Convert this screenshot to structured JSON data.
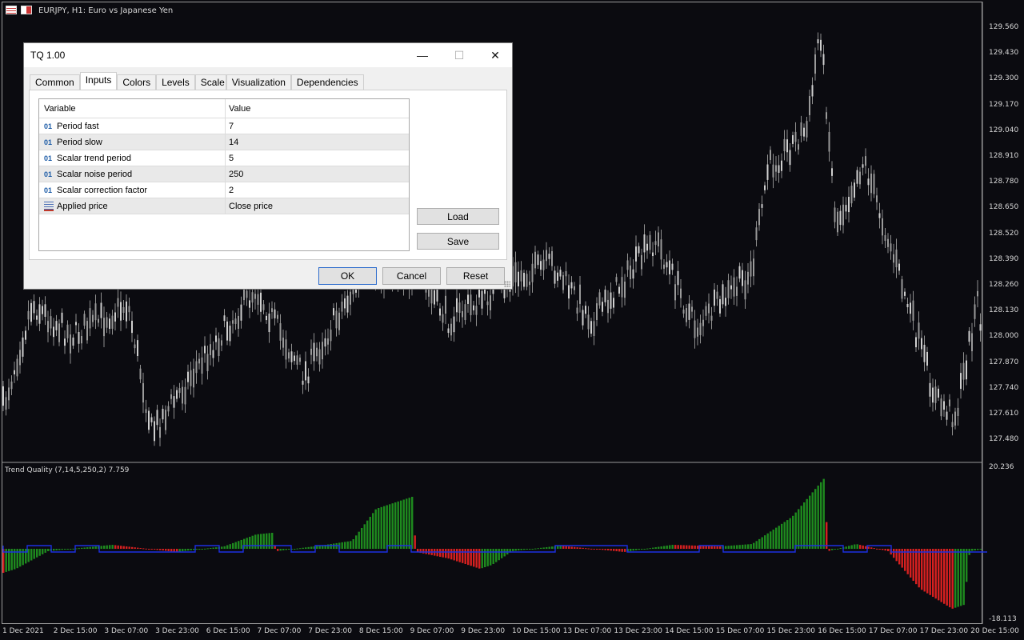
{
  "window": {
    "caption": "EURJPY, H1:  Euro vs Japanese Yen"
  },
  "price_axis": [
    "129.560",
    "129.430",
    "129.300",
    "129.170",
    "129.040",
    "128.910",
    "128.780",
    "128.650",
    "128.520",
    "128.390",
    "128.260",
    "128.130",
    "128.000",
    "127.870",
    "127.740",
    "127.610",
    "127.480"
  ],
  "indicator_axis": [
    "20.236",
    "-18.113"
  ],
  "time_axis": [
    "1 Dec 2021",
    "2 Dec 15:00",
    "3 Dec 07:00",
    "3 Dec 23:00",
    "6 Dec 15:00",
    "7 Dec 07:00",
    "7 Dec 23:00",
    "8 Dec 15:00",
    "9 Dec 07:00",
    "9 Dec 23:00",
    "10 Dec 15:00",
    "13 Dec 07:00",
    "13 Dec 23:00",
    "14 Dec 15:00",
    "15 Dec 07:00",
    "15 Dec 23:00",
    "16 Dec 15:00",
    "17 Dec 07:00",
    "17 Dec 23:00",
    "20 Dec 15:00"
  ],
  "indicator": {
    "title": "Trend Quality (7,14,5,250,2) 7.759",
    "colors": {
      "up": "#1e8a1e",
      "down": "#d62020",
      "line": "#1c2fe0"
    }
  },
  "dialog": {
    "title": "TQ 1.00",
    "minimize": "—",
    "maximize": "☐",
    "close": "✕",
    "tabs": [
      "Common",
      "Inputs",
      "Colors",
      "Levels",
      "Scale",
      "Visualization",
      "Dependencies"
    ],
    "active_tab": "Inputs",
    "grid": {
      "header": {
        "variable": "Variable",
        "value": "Value"
      },
      "rows": [
        {
          "type": "01",
          "name": "Period fast",
          "value": "7"
        },
        {
          "type": "01",
          "name": "Period slow",
          "value": "14"
        },
        {
          "type": "01",
          "name": "Scalar trend period",
          "value": "5"
        },
        {
          "type": "01",
          "name": "Scalar noise period",
          "value": "250"
        },
        {
          "type": "01",
          "name": "Scalar correction factor",
          "value": "2"
        },
        {
          "type": "list",
          "name": "Applied price",
          "value": "Close price"
        }
      ]
    },
    "buttons": {
      "load": "Load",
      "save": "Save",
      "ok": "OK",
      "cancel": "Cancel",
      "reset": "Reset"
    }
  }
}
